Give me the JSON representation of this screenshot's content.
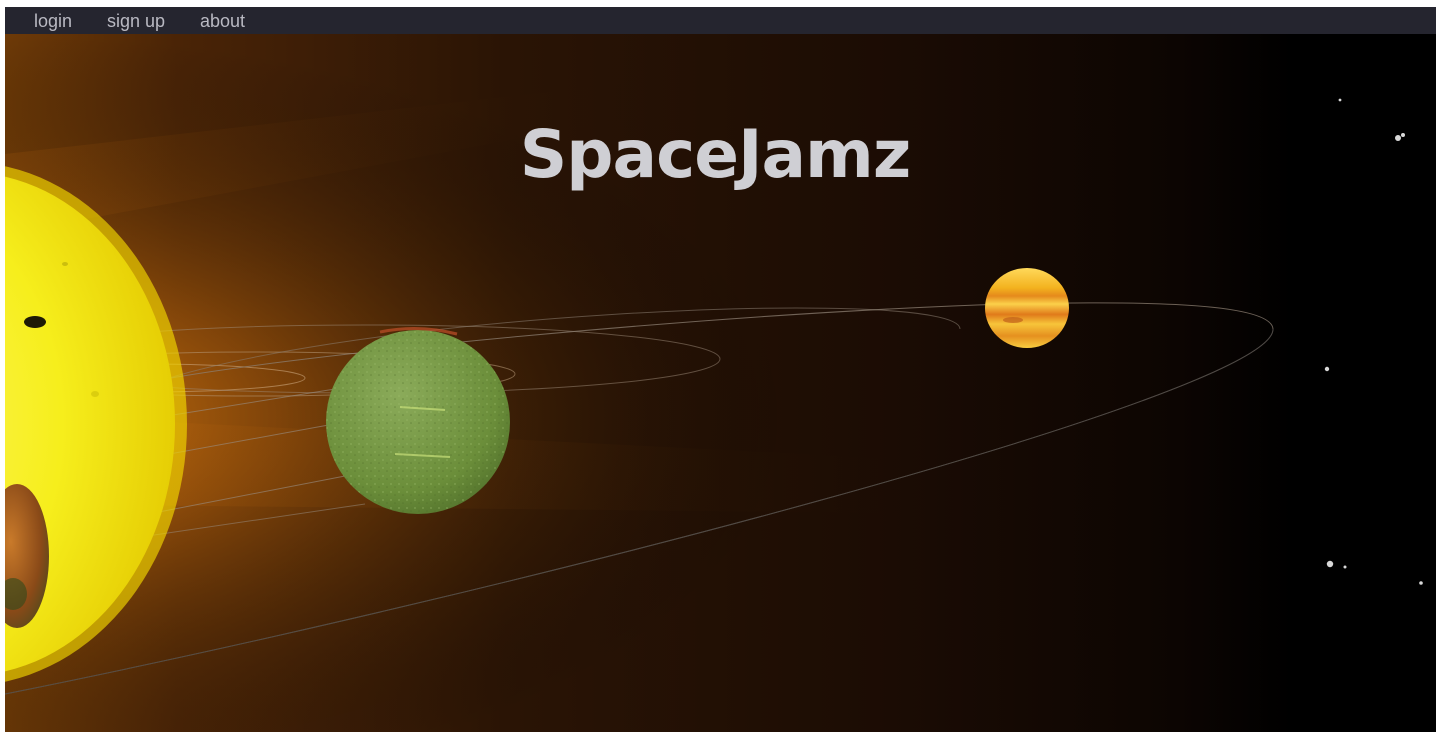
{
  "nav": {
    "login": "login",
    "signup": "sign up",
    "about": "about"
  },
  "title": "SpaceJamz",
  "colors": {
    "navbar": "#25252f",
    "nav_text": "#b9b9c2",
    "title_text": "#cfcfd4",
    "sun": "#f6ee1c",
    "glow": "#c9780f",
    "green_planet": "#6b8e3a",
    "jupiter": "#f4b81f",
    "orbit_line": "#8c7f72"
  },
  "scene": {
    "objects": [
      "sun",
      "mercury-like-planet",
      "green-planet",
      "jupiter-like-planet",
      "orbits",
      "stars"
    ]
  }
}
